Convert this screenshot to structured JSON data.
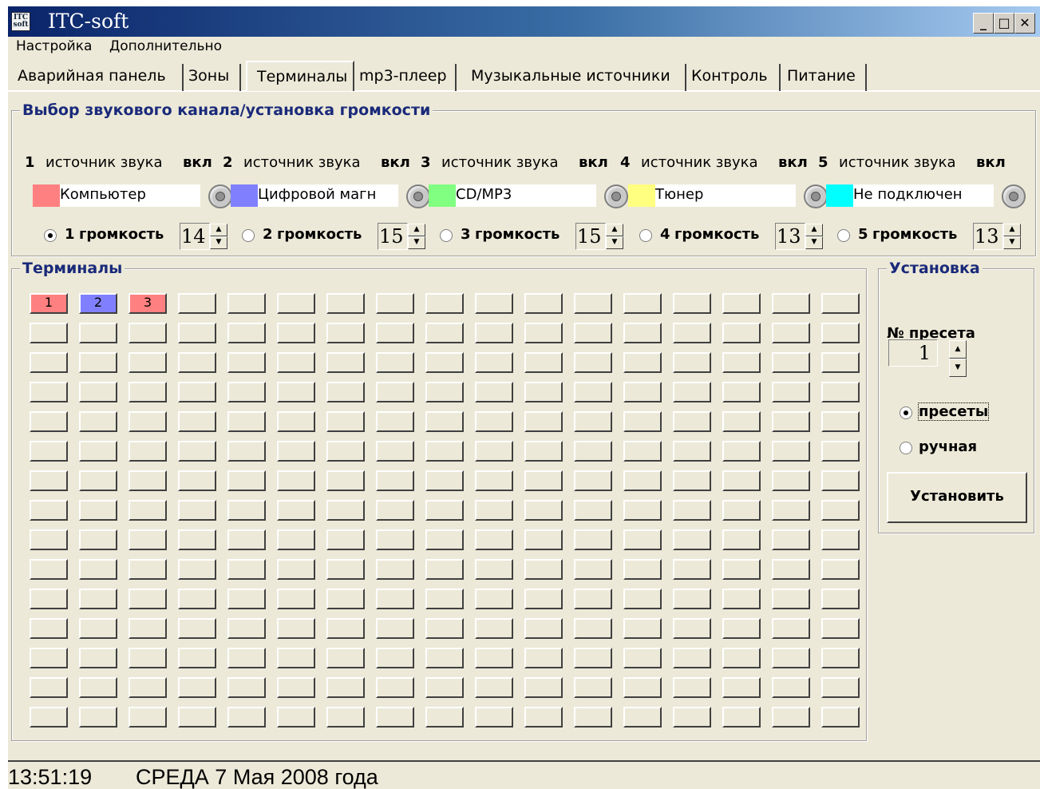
{
  "window": {
    "title": "ITC-soft",
    "icon_text": "ITC soft"
  },
  "menu": [
    "Настройка",
    "Дополнительно"
  ],
  "tabs": [
    {
      "label": "Аварийная панель",
      "active": false
    },
    {
      "label": "Зоны",
      "active": false
    },
    {
      "label": "Терминалы",
      "active": true
    },
    {
      "label": "mp3-плеер",
      "active": false
    },
    {
      "label": "Музыкальные источники",
      "active": false
    },
    {
      "label": "Контроль",
      "active": false
    },
    {
      "label": "Питание",
      "active": false
    }
  ],
  "channels_group": {
    "title": "Выбор звукового канала/установка громкости",
    "source_label": "источник звука",
    "on_label": "вкл",
    "volume_label": "громкость",
    "channels": [
      {
        "num": "1",
        "name": "Компьютер",
        "color": "#ff8080",
        "volume": "14",
        "selected": true
      },
      {
        "num": "2",
        "name": "Цифровой магн",
        "color": "#8080ff",
        "volume": "15",
        "selected": false
      },
      {
        "num": "3",
        "name": "CD/MP3",
        "color": "#80ff80",
        "volume": "15",
        "selected": false
      },
      {
        "num": "4",
        "name": "Тюнер",
        "color": "#ffff80",
        "volume": "13",
        "selected": false
      },
      {
        "num": "5",
        "name": "Не подключен",
        "color": "#00ffff",
        "volume": "13",
        "selected": false
      }
    ]
  },
  "terminals_group": {
    "title": "Терминалы",
    "rows": 15,
    "cols": 17,
    "assigned": [
      {
        "label": "1",
        "color": "#ff8080"
      },
      {
        "label": "2",
        "color": "#8080ff"
      },
      {
        "label": "3",
        "color": "#ff8080"
      }
    ]
  },
  "setup_group": {
    "title": "Установка",
    "preset_label": "№ пресета",
    "preset_value": "1",
    "mode_presets": "пресеты",
    "mode_manual": "ручная",
    "presets_selected": true,
    "set_button": "Установить"
  },
  "status": {
    "time": "13:51:19",
    "date": "СРЕДА 7 Мая 2008 года"
  }
}
